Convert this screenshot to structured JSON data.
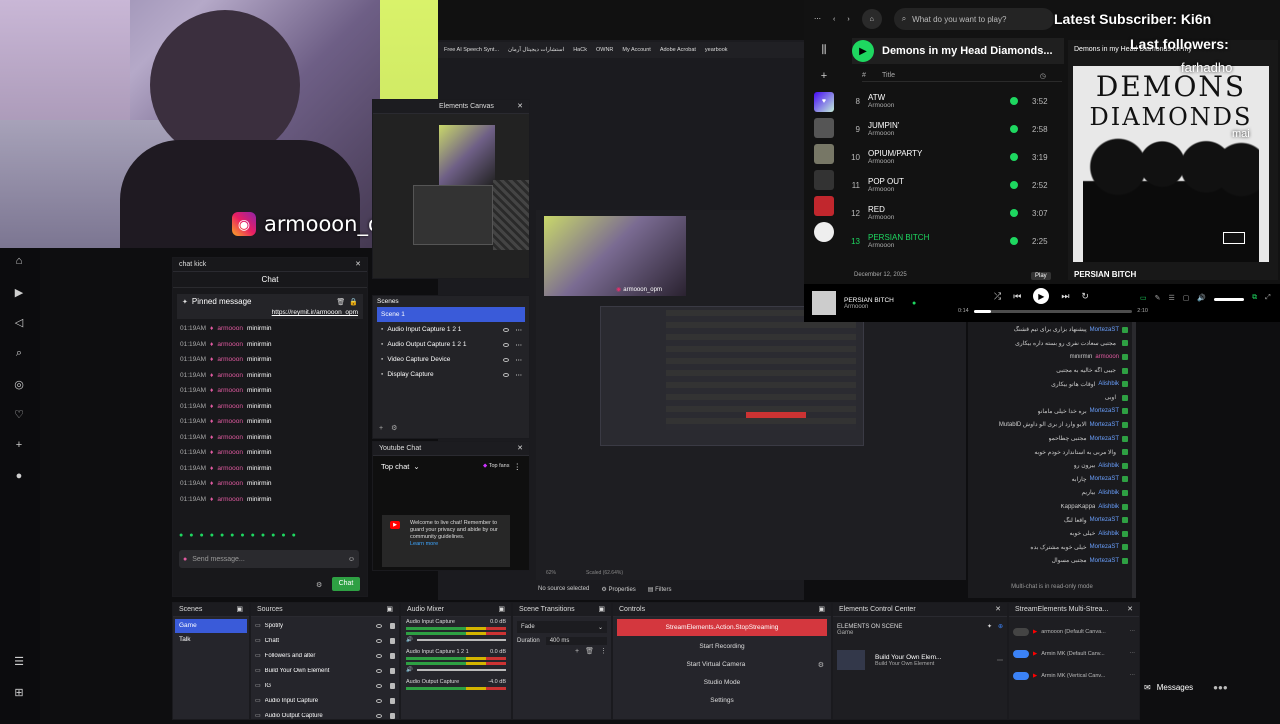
{
  "webcam": {
    "instagram_handle": "armooon_opm"
  },
  "left_rail": {
    "icons": [
      "home-icon",
      "video-icon",
      "compass-icon",
      "search-icon",
      "explore-icon",
      "heart-icon",
      "plus-icon",
      "avatar-icon",
      "menu-icon",
      "network-icon"
    ]
  },
  "kick_chat": {
    "dock_title": "chat kick",
    "header": "Chat",
    "pinned_label": "Pinned message",
    "pinned_link": "https://reymit.ir/armooon_opm",
    "lines": [
      {
        "time": "01:19AM",
        "user": "armooon",
        "msg": "minirmin"
      },
      {
        "time": "01:19AM",
        "user": "armooon",
        "msg": "minirmin"
      },
      {
        "time": "01:19AM",
        "user": "armooon",
        "msg": "minirmin"
      },
      {
        "time": "01:19AM",
        "user": "armooon",
        "msg": "minirmin"
      },
      {
        "time": "01:19AM",
        "user": "armooon",
        "msg": "minirmin"
      },
      {
        "time": "01:19AM",
        "user": "armooon",
        "msg": "minirmin"
      },
      {
        "time": "01:19AM",
        "user": "armooon",
        "msg": "minirmin"
      },
      {
        "time": "01:19AM",
        "user": "armooon",
        "msg": "minirmin"
      },
      {
        "time": "01:19AM",
        "user": "armooon",
        "msg": "minirmin"
      },
      {
        "time": "01:19AM",
        "user": "armooon",
        "msg": "minirmin"
      },
      {
        "time": "01:19AM",
        "user": "armooon",
        "msg": "minirmin"
      },
      {
        "time": "01:19AM",
        "user": "armooon",
        "msg": "minirmin"
      }
    ],
    "input_placeholder": "Send message...",
    "send_label": "Chat"
  },
  "browser": {
    "bookmarks": [
      "Free AI Speech Synt...",
      "استشارات دیجیتال آرمان",
      "HaCk",
      "OWNR",
      "My Account",
      "Adobe Acrobat",
      "yearbook"
    ]
  },
  "elements_canvas": {
    "title": "Elements Canvas"
  },
  "scenes_panel": {
    "title": "Scenes",
    "items": [
      "Scene 1",
      "Audio Input Capture 1 2 1",
      "Audio Output Capture 1 2 1",
      "Video Capture Device",
      "Display Capture"
    ]
  },
  "youtube_chat": {
    "title": "Youtube Chat",
    "mode": "Top chat",
    "top_fans": "Top fans",
    "welcome": "Welcome to live chat! Remember to guard your privacy and abide by our community guidelines.",
    "learn_more": "Learn more"
  },
  "preview": {
    "overlay_handle": "armooon_opm",
    "no_source": "No source selected",
    "properties": "Properties",
    "filters": "Filters",
    "status_left": "62%",
    "status_mid": "Scaled (62.64%)"
  },
  "spotify": {
    "search_placeholder": "What do you want to play?",
    "playlist_title": "Demons in my Head Diamonds...",
    "col_hash": "#",
    "col_title": "Title",
    "tracks": [
      {
        "num": "8",
        "title": "ATW",
        "artist": "Armooon",
        "duration": "3:52"
      },
      {
        "num": "9",
        "title": "JUMPIN'",
        "artist": "Armooon",
        "duration": "2:58"
      },
      {
        "num": "10",
        "title": "OPIUM/PARTY",
        "artist": "Armooon",
        "duration": "3:19"
      },
      {
        "num": "11",
        "title": "POP OUT",
        "artist": "Armooon",
        "duration": "2:52"
      },
      {
        "num": "12",
        "title": "RED",
        "artist": "Armooon",
        "duration": "3:07"
      },
      {
        "num": "13",
        "title": "PERSIAN BITCH",
        "artist": "Armooon",
        "duration": "2:25"
      }
    ],
    "date": "December 12, 2025",
    "now_playing_title": "PERSIAN BITCH",
    "now_playing_artist": "Armooon",
    "time_elapsed": "0:14",
    "time_total": "2:10",
    "progress": 0.11,
    "play_tooltip": "Play",
    "album_heading": "Demons in my Head Diamonds on my",
    "album_art_text_1": "DEMONS",
    "album_art_text_2": "DIAMONDS",
    "album_footer": "PERSIAN BITCH"
  },
  "overlay": {
    "latest_sub": "Latest Subscriber: Ki6n",
    "last_followers": "Last followers:",
    "follower_1": "farhadho",
    "follower_2": "mai"
  },
  "multichat": {
    "lines": [
      {
        "user": "MortezaST",
        "msg": "پیشنهاد بزاری برای تیم قشنگ"
      },
      {
        "user": "",
        "msg": "مجتبی سعادت نفری رو بسته داره بیکاری"
      },
      {
        "user": "armooon",
        "msg": "minirmin"
      },
      {
        "user": "",
        "msg": "جیبی اگه خالیه به مجتبی"
      },
      {
        "user": "Alishbik",
        "msg": "اوقات هاتو بیکاری"
      },
      {
        "user": "",
        "msg": "اوبی"
      },
      {
        "user": "MortezaST",
        "msg": "بره خدا خیلی مامانو"
      },
      {
        "user": "MortezaST",
        "msg": "الایو وارد از بری الو داوش MutablD"
      },
      {
        "user": "MortezaST",
        "msg": "مجتبی چطاحمو"
      },
      {
        "user": "",
        "msg": "والا مربی به استاندارد خودم خوبه"
      },
      {
        "user": "Alishbik",
        "msg": "بیرون رو"
      },
      {
        "user": "MortezaST",
        "msg": "چارابه"
      },
      {
        "user": "Alishbik",
        "msg": "بیاریم"
      },
      {
        "user": "Alishbik",
        "msg": "KappaKappa"
      },
      {
        "user": "MortezaST",
        "msg": "واقعا لنگ"
      },
      {
        "user": "Alishbik",
        "msg": "خیلی خوبه"
      },
      {
        "user": "MortezaST",
        "msg": "خیلی خوبه مشترک بده"
      },
      {
        "user": "MortezaST",
        "msg": "مجتبی مسوال"
      }
    ],
    "readonly": "Multi-chat is in read-only mode"
  },
  "obs": {
    "scenes": {
      "title": "Scenes",
      "items": [
        "Game",
        "Talk"
      ],
      "selected": 0
    },
    "sources": {
      "title": "Sources",
      "items": [
        "Spotify",
        "Chatt",
        "Followers and alter",
        "Build Your Own Element",
        "IG",
        "Audio Input Capture",
        "Audio Output Capture"
      ]
    },
    "mixer": {
      "title": "Audio Mixer",
      "ch1": "Audio Input Capture",
      "ch1_db": "0.0 dB",
      "ch2": "Audio Input Capture 1 2 1",
      "ch2_db": "0.0 dB",
      "ch3": "Audio Output Capture",
      "ch3_db": "-4.0 dB"
    },
    "transitions": {
      "title": "Scene Transitions",
      "type": "Fade",
      "duration_label": "Duration",
      "duration": "400 ms"
    },
    "controls": {
      "title": "Controls",
      "stream": "StreamElements.Action.StopStreaming",
      "record": "Start Recording",
      "virtual_cam": "Start Virtual Camera",
      "studio": "Studio Mode",
      "settings": "Settings"
    },
    "elements": {
      "title": "Elements Control Center",
      "on_scene": "ELEMENTS ON SCENE",
      "scene": "Game",
      "item_title": "Build Your Own Elem...",
      "item_sub": "Build Your Own Element"
    },
    "multistream": {
      "title": "StreamElements Multi-Strea...",
      "rows": [
        {
          "name": "armooon (Default Canva..."
        },
        {
          "name": "Armin MK (Default Canv..."
        },
        {
          "name": "Armin MK (Vertical Canv..."
        }
      ]
    }
  },
  "taskbar": {
    "messages": "Messages"
  }
}
